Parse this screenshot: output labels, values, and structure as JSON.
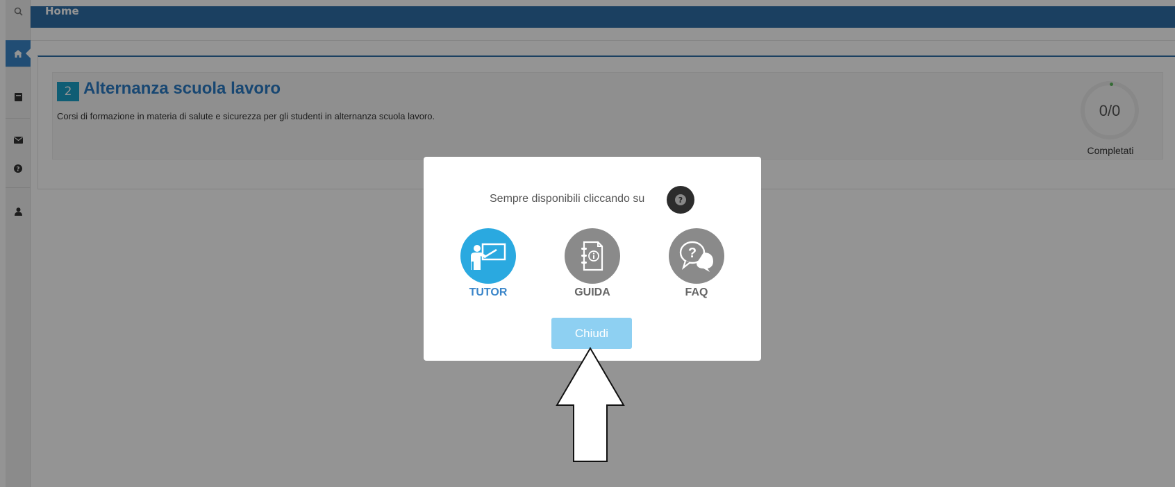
{
  "header": {
    "title": "Home"
  },
  "card": {
    "number": "2",
    "title": "Alternanza scuola lavoro",
    "description": "Corsi di formazione in materia di salute e sicurezza per gli studenti in alternanza scuola lavoro.",
    "progress_value": "0/0",
    "progress_label": "Completati"
  },
  "sidebar": {
    "items": [
      {
        "icon": "search-icon"
      },
      {
        "icon": "home-icon",
        "active": true
      },
      {
        "icon": "book-icon"
      },
      {
        "icon": "envelope-icon"
      },
      {
        "icon": "question-icon"
      },
      {
        "icon": "user-icon"
      }
    ]
  },
  "modal": {
    "text": "Sempre disponibili cliccando su",
    "help_icon": "question-circle-icon",
    "options": [
      {
        "label": "TUTOR",
        "icon": "teacher-icon"
      },
      {
        "label": "GUIDA",
        "icon": "guide-book-icon"
      },
      {
        "label": "FAQ",
        "icon": "faq-chat-icon"
      }
    ],
    "close_button": "Chiudi"
  },
  "colors": {
    "topbar": "#2f6ea8",
    "accent": "#2a7bc4",
    "tutor": "#2aa9e0",
    "button": "#8ed0f2"
  }
}
